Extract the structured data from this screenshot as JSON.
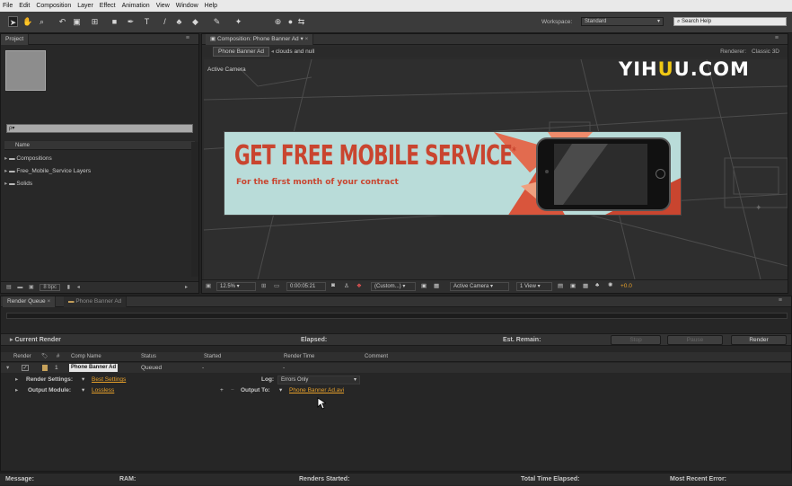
{
  "menu": [
    "File",
    "Edit",
    "Composition",
    "Layer",
    "Effect",
    "Animation",
    "View",
    "Window",
    "Help"
  ],
  "toolbar": {
    "workspace_label": "Workspace:",
    "workspace_value": "Standard",
    "search_placeholder": "Search Help"
  },
  "project": {
    "tab": "Project",
    "search_placeholder": "ρ▾",
    "col_name": "Name",
    "items": [
      "Compositions",
      "Free_Mobile_Service Layers",
      "Solids"
    ],
    "bpc": "8 bpc"
  },
  "comp": {
    "tab": "Composition: Phone Banner Ad",
    "breadcrumb": [
      "Phone Banner Ad",
      "clouds and null"
    ],
    "renderer": "Renderer:",
    "renderer_value": "Classic 3D",
    "active_camera": "Active Camera",
    "zoom": "12.5%",
    "timecode": "0:00:05:21",
    "resolution": "(Custom...)",
    "camera_view": "Active Camera",
    "views": "1 View",
    "exposure": "+0.0"
  },
  "banner": {
    "headline": "GET FREE MOBILE SERVICE",
    "sup": "*",
    "subline": "For the first month of your contract",
    "bg": "#b9dcd9",
    "accent": "#c9452f"
  },
  "watermark": {
    "pre": "YI",
    "mid": "H",
    "u": "U",
    "post": "U.COM"
  },
  "render_queue": {
    "tabs": [
      "Render Queue",
      "Phone Banner Ad"
    ],
    "current_render": "Current Render",
    "elapsed": "Elapsed:",
    "est_remain": "Est. Remain:",
    "stop": "Stop",
    "pause": "Pause",
    "render": "Render",
    "columns": [
      "Render",
      "#",
      "Comp Name",
      "Status",
      "Started",
      "Render Time",
      "Comment"
    ],
    "item": {
      "num": "1",
      "comp": "Phone Banner Ad",
      "status": "Queued",
      "started": "-",
      "render_time": "-"
    },
    "render_settings_label": "Render Settings:",
    "render_settings_value": "Best Settings",
    "log_label": "Log:",
    "log_value": "Errors Only",
    "output_module_label": "Output Module:",
    "output_module_value": "Lossless",
    "output_to_label": "Output To:",
    "output_to_value": "Phone Banner Ad.avi"
  },
  "status_bar": {
    "message": "Message:",
    "ram": "RAM:",
    "renders_started": "Renders Started:",
    "total_time": "Total Time Elapsed:",
    "recent_error": "Most Recent Error:"
  }
}
